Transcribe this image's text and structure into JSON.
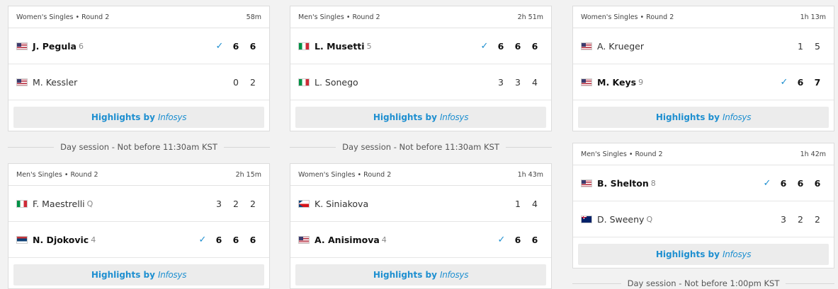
{
  "highlights": {
    "label": "Highlights by",
    "brand": "Infosys"
  },
  "sessions": {
    "col1": "Day session - Not before 11:30am KST",
    "col2": "Day session - Not before 11:30am KST",
    "col3": "Day session - Not before 1:00pm KST"
  },
  "matches": [
    {
      "category": "Women's Singles • Round 2",
      "duration": "58m",
      "players": [
        {
          "name": "J. Pegula",
          "seed": "6",
          "flag": "us",
          "winner": true,
          "scores": [
            "6",
            "6"
          ]
        },
        {
          "name": "M. Kessler",
          "seed": "",
          "flag": "us",
          "winner": false,
          "scores": [
            "0",
            "2"
          ]
        }
      ]
    },
    {
      "category": "Men's Singles • Round 2",
      "duration": "2h 51m",
      "players": [
        {
          "name": "L. Musetti",
          "seed": "5",
          "flag": "it",
          "winner": true,
          "scores": [
            "6",
            "6",
            "6"
          ]
        },
        {
          "name": "L. Sonego",
          "seed": "",
          "flag": "it",
          "winner": false,
          "scores": [
            "3",
            "3",
            "4"
          ]
        }
      ]
    },
    {
      "category": "Women's Singles • Round 2",
      "duration": "1h 13m",
      "players": [
        {
          "name": "A. Krueger",
          "seed": "",
          "flag": "us",
          "winner": false,
          "scores": [
            "1",
            "5"
          ]
        },
        {
          "name": "M. Keys",
          "seed": "9",
          "flag": "us",
          "winner": true,
          "scores": [
            "6",
            "7"
          ]
        }
      ]
    },
    {
      "category": "Men's Singles • Round 2",
      "duration": "2h 15m",
      "players": [
        {
          "name": "F. Maestrelli",
          "seed": "Q",
          "flag": "it",
          "winner": false,
          "scores": [
            "3",
            "2",
            "2"
          ]
        },
        {
          "name": "N. Djokovic",
          "seed": "4",
          "flag": "rs",
          "winner": true,
          "scores": [
            "6",
            "6",
            "6"
          ]
        }
      ]
    },
    {
      "category": "Women's Singles • Round 2",
      "duration": "1h 43m",
      "players": [
        {
          "name": "K. Siniakova",
          "seed": "",
          "flag": "cz",
          "winner": false,
          "scores": [
            "1",
            "4"
          ]
        },
        {
          "name": "A. Anisimova",
          "seed": "4",
          "flag": "us",
          "winner": true,
          "scores": [
            "6",
            "6"
          ]
        }
      ]
    },
    {
      "category": "Men's Singles • Round 2",
      "duration": "1h 42m",
      "players": [
        {
          "name": "B. Shelton",
          "seed": "8",
          "flag": "us",
          "winner": true,
          "scores": [
            "6",
            "6",
            "6"
          ]
        },
        {
          "name": "D. Sweeny",
          "seed": "Q",
          "flag": "au",
          "winner": false,
          "scores": [
            "3",
            "2",
            "2"
          ]
        }
      ]
    }
  ]
}
